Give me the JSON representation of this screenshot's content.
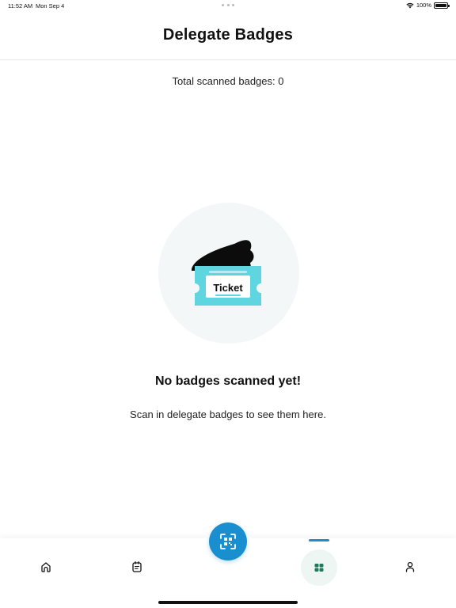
{
  "status_bar": {
    "time": "11:52 AM",
    "date": "Mon Sep 4",
    "battery": "100%",
    "battery_level": 1.0
  },
  "header": {
    "title": "Delegate Badges"
  },
  "summary": {
    "total_label": "Total scanned badges: 0"
  },
  "empty_state": {
    "illustration_text": "Ticket",
    "title": "No badges scanned yet!",
    "subtitle": "Scan in delegate badges to see them here."
  },
  "tab_bar": {
    "tabs": [
      {
        "icon": "home-icon"
      },
      {
        "icon": "agenda-icon"
      },
      {
        "icon": "qr-scan-icon"
      },
      {
        "icon": "badges-icon",
        "active": true
      },
      {
        "icon": "profile-icon"
      }
    ]
  },
  "colors": {
    "accent": "#1a8fd0",
    "ticket_cyan": "#5fd5e0",
    "circle_bg": "#f3f7f7",
    "badge_tab_bg": "#eef6f4"
  }
}
